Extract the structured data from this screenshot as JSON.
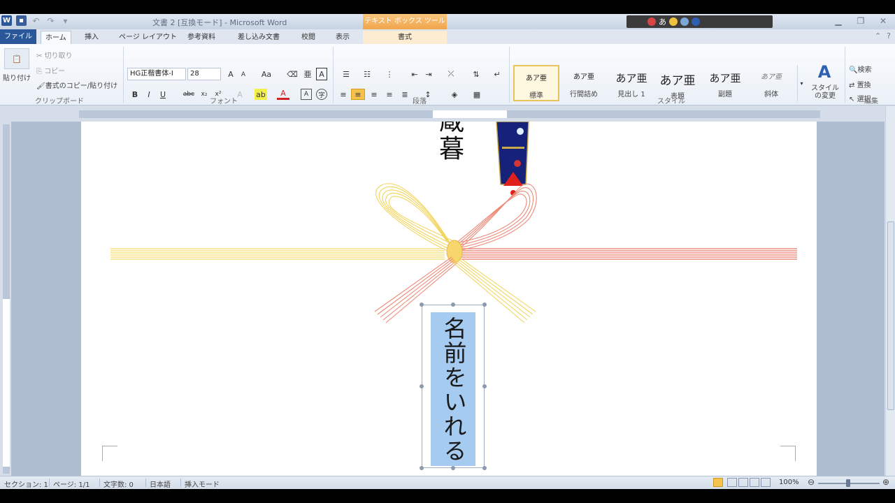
{
  "window": {
    "title": "文書 2 [互換モード] - Microsoft Word",
    "context_tab_group": "テキスト ボックス ツール"
  },
  "tabs": {
    "file": "ファイル",
    "home": "ホーム",
    "insert": "挿入",
    "page_layout": "ページ レイアウト",
    "references": "参考資料",
    "mailings": "差し込み文書",
    "review": "校閲",
    "view": "表示",
    "format": "書式"
  },
  "ribbon": {
    "clipboard": {
      "paste": "貼り付け",
      "cut": "切り取り",
      "copy": "コピー",
      "format_painter": "書式のコピー/貼り付け",
      "label": "クリップボード"
    },
    "font": {
      "font_name": "HG正楷書体-I",
      "font_size": "28",
      "label": "フォント"
    },
    "paragraph": {
      "label": "段落"
    },
    "styles": {
      "label": "スタイル",
      "items": [
        {
          "sample": "あア亜",
          "name": "標準"
        },
        {
          "sample": "あア亜",
          "name": "行間詰め"
        },
        {
          "sample": "あア亜",
          "name": "見出し 1"
        },
        {
          "sample": "あア亜",
          "name": "表題"
        },
        {
          "sample": "あア亜",
          "name": "副題"
        },
        {
          "sample": "あア亜",
          "name": "斜体"
        }
      ],
      "change_styles": "スタイルの変更"
    },
    "editing": {
      "find": "検索",
      "replace": "置換",
      "select": "選択",
      "label": "編集"
    }
  },
  "document": {
    "heading_partial": "蔵",
    "heading_char": "暮",
    "textbox_text": "名前をいれる"
  },
  "statusbar": {
    "section": "セクション: 1",
    "page": "ページ: 1/1",
    "word_count": "文字数: 0",
    "language": "日本語",
    "insert_mode": "挿入モード",
    "zoom": "100%"
  },
  "colors": {
    "ribbon_file": "#2a579a",
    "context_tab": "#f1a449",
    "textbox_fill": "#a6cbf0",
    "cord_yellow": "#f7dc6f",
    "cord_red": "#e77b66",
    "noshi_blue": "#16217a"
  }
}
